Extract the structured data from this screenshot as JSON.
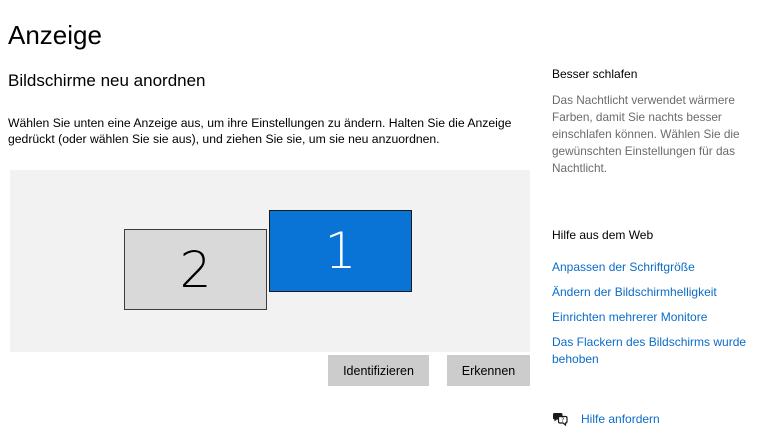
{
  "page": {
    "title": "Anzeige"
  },
  "arrange": {
    "heading": "Bildschirme neu anordnen",
    "instruction": "Wählen Sie unten eine Anzeige aus, um ihre Einstellungen zu ändern. Halten Sie die Anzeige gedrückt (oder wählen Sie sie aus), und ziehen Sie sie, um sie neu anzuordnen.",
    "monitors": [
      {
        "number": "1",
        "selected": true,
        "color": "#0a74d6"
      },
      {
        "number": "2",
        "selected": false,
        "color": "#d9d9d9"
      }
    ],
    "identify_label": "Identifizieren",
    "detect_label": "Erkennen"
  },
  "sidebar": {
    "sleep_heading": "Besser schlafen",
    "sleep_text": "Das Nachtlicht verwendet wärmere Farben, damit Sie nachts besser einschlafen können. Wählen Sie die gewünschten Einstellungen für das Nachtlicht.",
    "web_help_heading": "Hilfe aus dem Web",
    "links": [
      "Anpassen der Schriftgröße",
      "Ändern der Bildschirmhelligkeit",
      "Einrichten mehrerer Monitore",
      "Das Flackern des Bildschirms wurde behoben"
    ],
    "get_help_label": "Hilfe anfordern",
    "get_help_icon": "chat-help-icon"
  },
  "colors": {
    "accent": "#0a74d6",
    "link": "#0b6cc9",
    "button_bg": "#cccccc",
    "arrange_bg": "#f2f2f2"
  }
}
